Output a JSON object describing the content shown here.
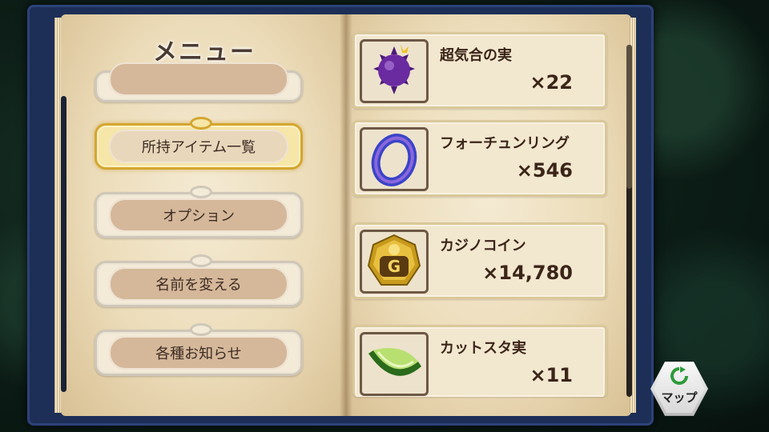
{
  "menu": {
    "title": "メニュー",
    "items": [
      {
        "label": "所持アイテム一覧",
        "active": true
      },
      {
        "label": "オプション",
        "active": false
      },
      {
        "label": "名前を変える",
        "active": false
      },
      {
        "label": "各種お知らせ",
        "active": false
      }
    ]
  },
  "inventory": {
    "items": [
      {
        "name": "超気合の実",
        "quantity": "×22",
        "icon": "spiky-purple-fruit-icon"
      },
      {
        "name": "フォーチュンリング",
        "quantity": "×546",
        "icon": "blue-ring-icon"
      },
      {
        "name": "カジノコイン",
        "quantity": "×14,780",
        "icon": "casino-coin-icon"
      },
      {
        "name": "カットスタ実",
        "quantity": "×11",
        "icon": "melon-slice-icon"
      }
    ]
  },
  "map_button": {
    "label": "マップ",
    "icon": "refresh-arrow-icon"
  },
  "colors": {
    "book_cover": "#1d2f57",
    "page": "#f4ead3",
    "active_frame": "#d4a630"
  }
}
